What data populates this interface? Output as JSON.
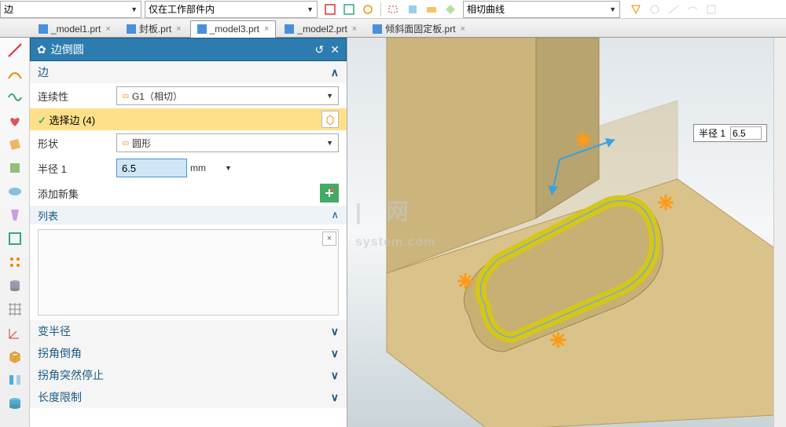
{
  "topbar": {
    "dropdown_a": "边",
    "dropdown_b": "仅在工作部件内",
    "dropdown_c": "相切曲线"
  },
  "tabs": [
    {
      "label": "_model1.prt",
      "active": false
    },
    {
      "label": "封板.prt",
      "active": false
    },
    {
      "label": "_model3.prt",
      "active": true
    },
    {
      "label": "_model2.prt",
      "active": false
    },
    {
      "label": "倾斜面固定板.prt",
      "active": false
    }
  ],
  "panel": {
    "title": "边倒圆",
    "section_edge": "边",
    "continuity_label": "连续性",
    "continuity_value": "G1（相切）",
    "select_edge_label": "选择边 (4)",
    "shape_label": "形状",
    "shape_value": "圆形",
    "radius_label": "半径 1",
    "radius_value": "6.5",
    "radius_unit": "mm",
    "add_set_label": "添加新集",
    "list_label": "列表",
    "section_var": "变半径",
    "section_corner": "拐角倒角",
    "section_stop": "拐角突然停止",
    "section_length": "长度限制"
  },
  "viewport": {
    "float_label": "半径 1",
    "float_value": "6.5"
  },
  "watermark": {
    "line1": "网",
    "line2": "system.com"
  }
}
